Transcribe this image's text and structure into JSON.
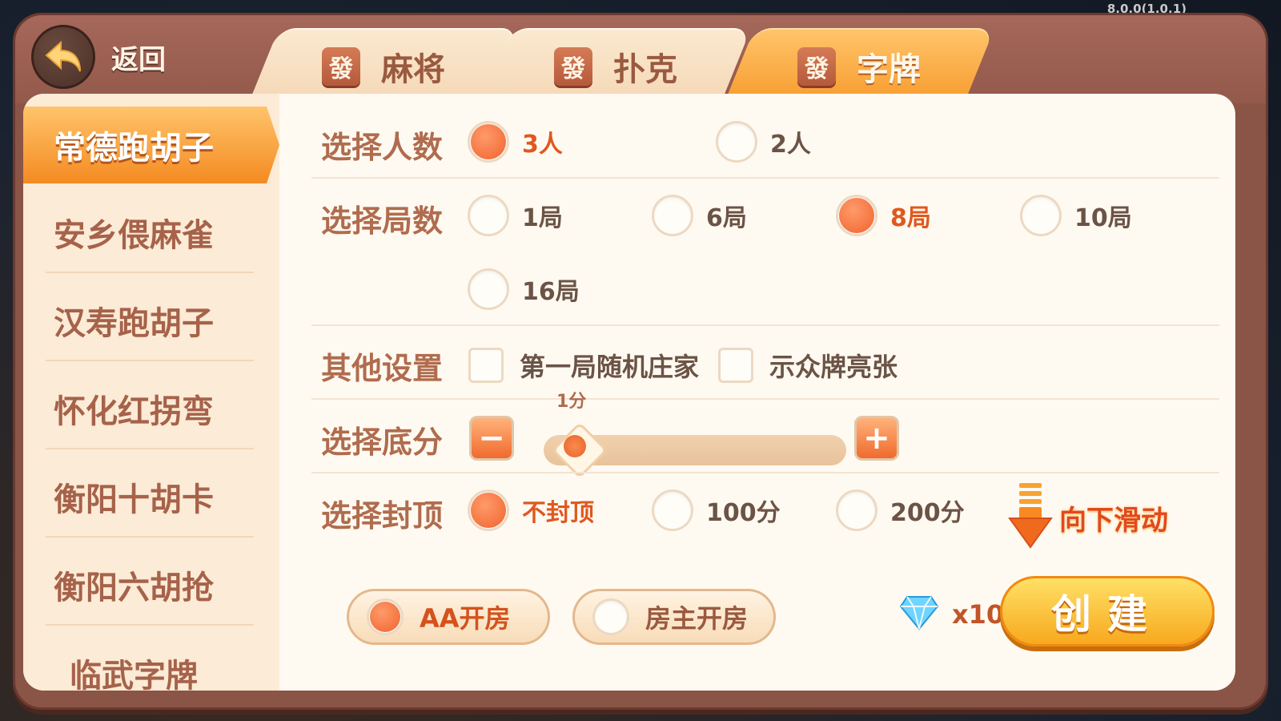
{
  "version": "8.0.0(1.0.1)",
  "header": {
    "back_label": "返回",
    "tabs": [
      {
        "icon": "發",
        "label": "麻将",
        "active": false
      },
      {
        "icon": "發",
        "label": "扑克",
        "active": false
      },
      {
        "icon": "發",
        "label": "字牌",
        "active": true
      }
    ]
  },
  "sidebar": {
    "items": [
      {
        "label": "常德跑胡子",
        "active": true
      },
      {
        "label": "安乡偎麻雀",
        "active": false
      },
      {
        "label": "汉寿跑胡子",
        "active": false
      },
      {
        "label": "怀化红拐弯",
        "active": false
      },
      {
        "label": "衡阳十胡卡",
        "active": false
      },
      {
        "label": "衡阳六胡抢",
        "active": false
      },
      {
        "label": "临武字牌",
        "active": false
      }
    ]
  },
  "settings": {
    "players": {
      "label": "选择人数",
      "options": [
        {
          "text": "3人",
          "selected": true
        },
        {
          "text": "2人",
          "selected": false
        }
      ]
    },
    "rounds": {
      "label": "选择局数",
      "options": [
        {
          "text": "1局",
          "selected": false
        },
        {
          "text": "6局",
          "selected": false
        },
        {
          "text": "8局",
          "selected": true
        },
        {
          "text": "10局",
          "selected": false
        },
        {
          "text": "16局",
          "selected": false
        }
      ]
    },
    "other": {
      "label": "其他设置",
      "options": [
        {
          "text": "第一局随机庄家",
          "checked": false
        },
        {
          "text": "示众牌亮张",
          "checked": false
        }
      ]
    },
    "base_score": {
      "label": "选择底分",
      "value_label": "1分",
      "minus": "−",
      "plus": "+",
      "level": 0
    },
    "cap": {
      "label": "选择封顶",
      "options": [
        {
          "text": "不封顶",
          "selected": true
        },
        {
          "text": "100分",
          "selected": false
        },
        {
          "text": "200分",
          "selected": false
        }
      ]
    },
    "scroll_hint": "向下滑动"
  },
  "footer": {
    "pay_options": [
      {
        "text": "AA开房",
        "selected": true
      },
      {
        "text": "房主开房",
        "selected": false
      }
    ],
    "cost": "x10",
    "create_label": "创建"
  }
}
